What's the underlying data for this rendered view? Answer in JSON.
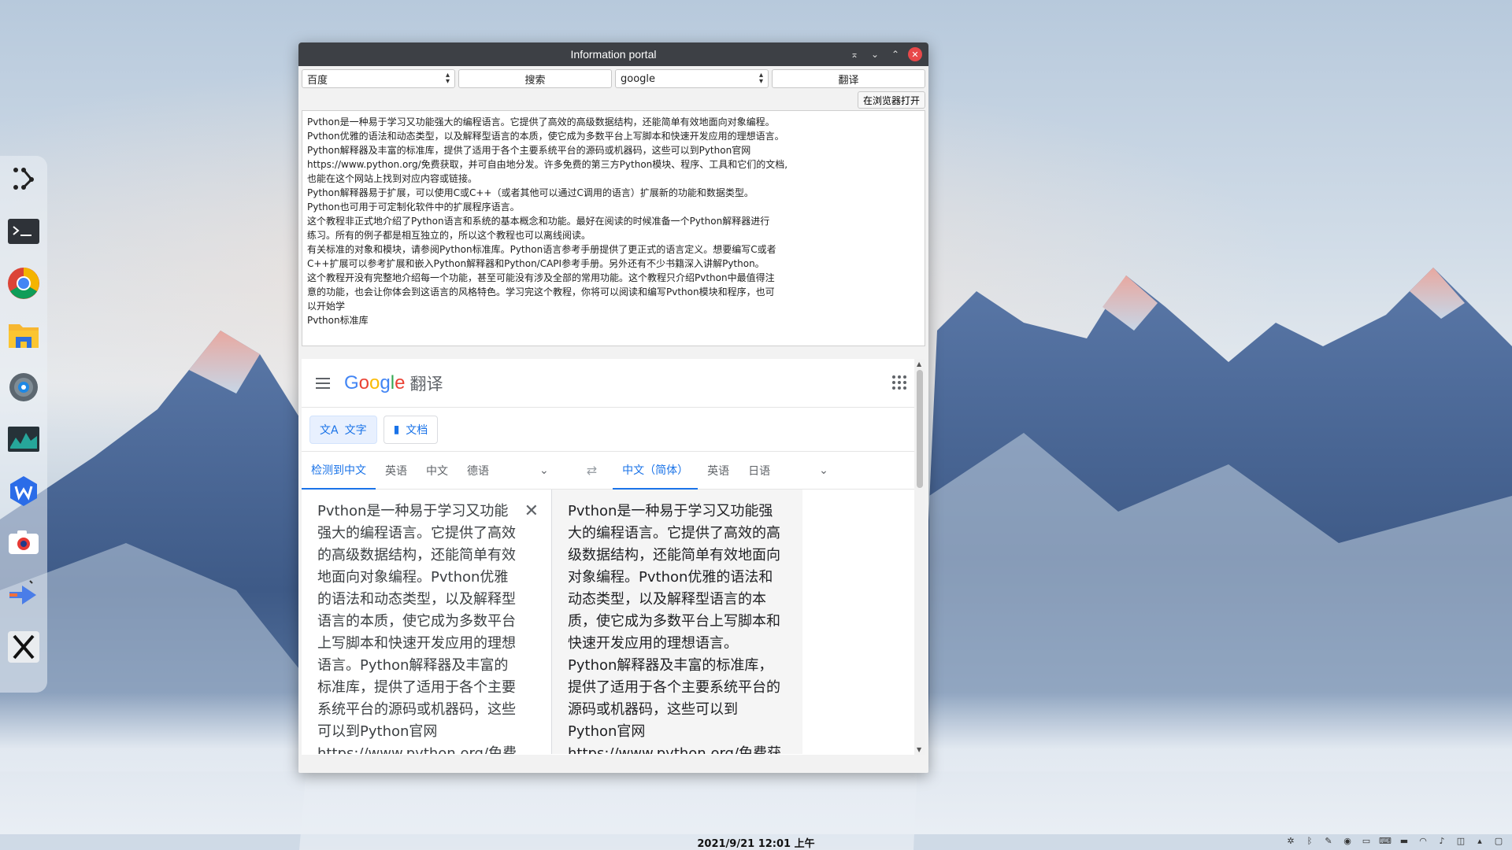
{
  "window": {
    "title": "Information portal"
  },
  "toolbar": {
    "engine_select": "百度",
    "search_button": "搜索",
    "translator_select": "google",
    "translate_button": "翻译",
    "open_browser_button": "在浏览器打开"
  },
  "text_lines": [
    "Pvthon是一种易于学习又功能强大的编程语言。它提供了高效的高级数据结构，还能简单有效地面向对象编程。",
    "Pvthon优雅的语法和动态类型，以及解释型语言的本质，使它成为多数平台上写脚本和快速开发应用的理想语言。",
    "Python解释器及丰富的标准库，提供了适用于各个主要系统平台的源码或机器码，这些可以到Python官网",
    "https://www.python.org/免费获取，并可自由地分发。许多免费的第三方Python模块、程序、工具和它们的文档,",
    "也能在这个网站上找到对应内容或链接。",
    "Python解释器易于扩展，可以使用C或C++（或者其他可以通过C调用的语言）扩展新的功能和数据类型。",
    "Python也可用于可定制化软件中的扩展程序语言。",
    "这个教程非正式地介绍了Python语言和系统的基本概念和功能。最好在阅读的时候准备一个Python解释器进行",
    "练习。所有的例子都是相互独立的，所以这个教程也可以离线阅读。",
    "有关标准的对象和模块，请参阅Python标准库。Python语言参考手册提供了更正式的语言定义。想要编写C或者",
    "C++扩展可以参考扩展和嵌入Python解释器和Python/CAPI参考手册。另外还有不少书籍深入讲解Python。",
    "这个教程开没有完整地介绍每一个功能，甚至可能没有涉及全部的常用功能。这个教程只介绍Pvthon中最值得注",
    "意的功能，也会让你体会到这语言的风格特色。学习完这个教程，你将可以阅读和编写Pvthon模块和程序，也可",
    "以开始学",
    "Pvthon标准库"
  ],
  "gt": {
    "logo": [
      "G",
      "o",
      "o",
      "g",
      "l",
      "e"
    ],
    "product": "翻译",
    "mode_text": "文字",
    "mode_doc": "文档",
    "src_langs": [
      "检测到中文",
      "英语",
      "中文",
      "德语"
    ],
    "dst_langs": [
      "中文（简体）",
      "英语",
      "日语"
    ],
    "src_text": "Pvthon是一种易于学习又功能强大的编程语言。它提供了高效的高级数据结构，还能简单有效地面向对象编程。Pvthon优雅的语法和动态类型，以及解释型语言的本质，使它成为多数平台上写脚本和快速开发应用的理想语言。Python解释器及丰富的标准库，提供了适用于各个主要系统平台的源码或机器码，这些可以到Python官网 https://www.python.org/免费获取，并可自由地分发。许多免费的第三方",
    "dst_text": "Pvthon是一种易于学习又功能强大的编程语言。它提供了高效的高级数据结构，还能简单有效地面向对象编程。Pvthon优雅的语法和动态类型，以及解释型语言的本质，使它成为多数平台上写脚本和快速开发应用的理想语言。Python解释器及丰富的标准库，提供了适用于各个主要系统平台的源码或机器码，这些可以到Python官网 https://www.python.org/免费获取，并可自由地分发。许多免费的第三方"
  },
  "taskbar": {
    "datetime": "2021/9/21  12:01 上午"
  },
  "dock_icons": [
    "launcher-icon",
    "terminal-icon",
    "chrome-icon",
    "file-manager-icon",
    "settings-icon",
    "system-monitor-icon",
    "wps-icon",
    "screenshot-icon",
    "media-icon",
    "x-app-icon"
  ],
  "colors": {
    "google_blue": "#4285f4",
    "google_red": "#ea4335",
    "google_yellow": "#fbbc05",
    "google_green": "#34a853",
    "accent": "#1a73e8",
    "close_button": "#e8484a"
  }
}
